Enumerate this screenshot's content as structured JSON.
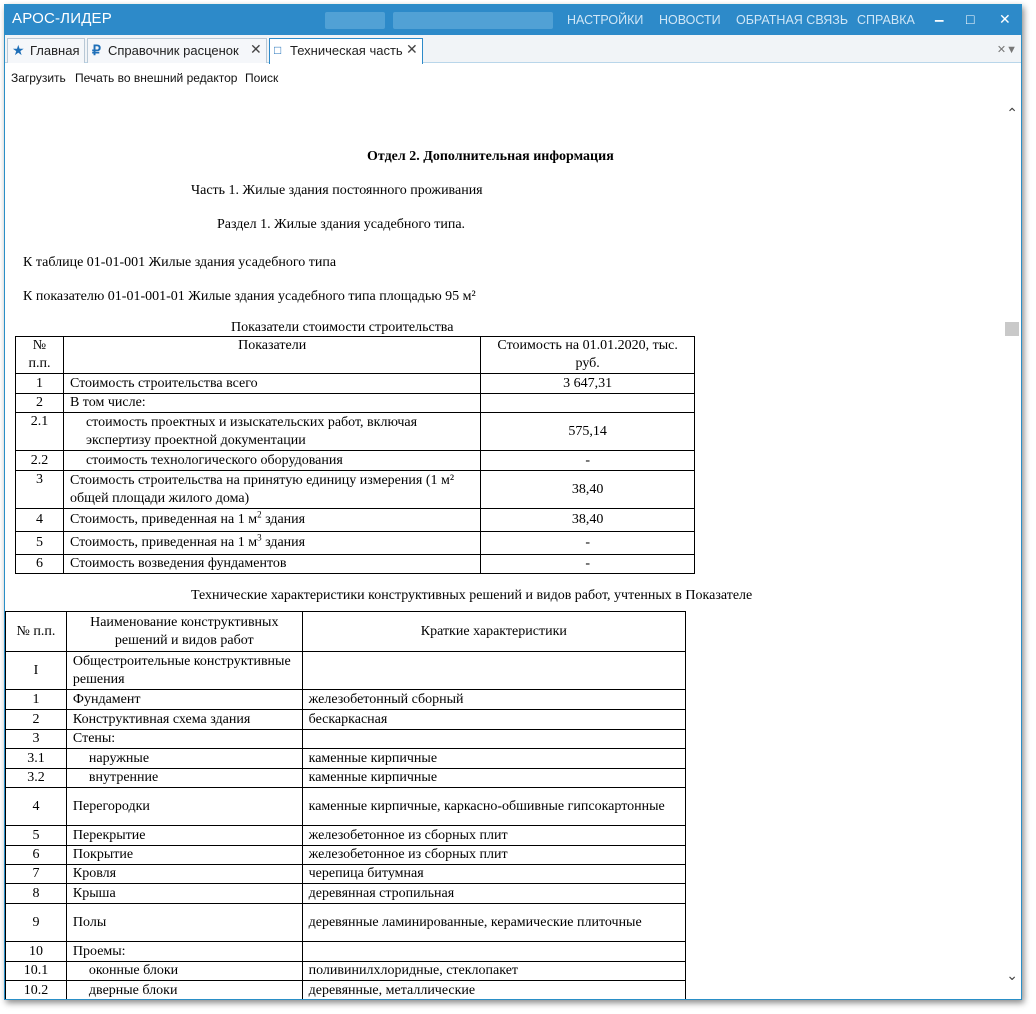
{
  "app": {
    "title": "АРОС-ЛИДЕР",
    "menu": [
      "НАСТРОЙКИ",
      "НОВОСТИ",
      "ОБРАТНАЯ СВЯЗЬ",
      "СПРАВКА"
    ],
    "window_controls": {
      "minimize": "▁",
      "maximize": "□",
      "close": "✕"
    }
  },
  "tabs": [
    {
      "label": "Главная",
      "icon": "star-icon",
      "glyph": "★"
    },
    {
      "label": "Справочник расценок",
      "icon": "ruble-icon",
      "glyph": "₽",
      "close": "✕"
    },
    {
      "label": "Техническая часть",
      "icon": "book-icon",
      "glyph": "📖",
      "close": "✕"
    }
  ],
  "tab_menu": "✕▼",
  "toolbar": {
    "load": "Загрузить",
    "print": "Печать во внешний редактор",
    "search": "Поиск"
  },
  "document": {
    "heading": "Отдел 2. Дополнительная информация",
    "part": "Часть 1. Жилые здания постоянного проживания",
    "section": "Раздел 1. Жилые здания усадебного типа.",
    "table_ref": "К таблице 01-01-001 Жилые здания усадебного типа",
    "indicator_ref": "К показателю 01-01-001-01 Жилые здания усадебного типа площадью 95 м²",
    "table1_caption": "Показатели стоимости строительства",
    "table1_headers": [
      "№ п.п.",
      "Показатели",
      "Стоимость  на 01.01.2020, тыс. руб."
    ],
    "table1_rows": [
      {
        "num": "1",
        "name": "Стоимость строительства всего",
        "value": "3 647,31"
      },
      {
        "num": "2",
        "name": "В том числе:",
        "value": ""
      },
      {
        "num": "2.1",
        "name": "стоимость проектных и изыскательских работ, включая экспертизу проектной документации",
        "value": "575,14"
      },
      {
        "num": "2.2",
        "name": "стоимость технологического оборудования",
        "value": "-"
      },
      {
        "num": "3",
        "name": "Стоимость строительства на принятую единицу измерения (1 м² общей площади жилого дома)",
        "value": "38,40"
      },
      {
        "num": "4",
        "name_pre": "Стоимость, приведенная на 1 м",
        "sup": "2",
        "name_post": " здания",
        "value": "38,40"
      },
      {
        "num": "5",
        "name_pre": "Стоимость, приведенная на 1 м",
        "sup": "3",
        "name_post": " здания",
        "value": "-"
      },
      {
        "num": "6",
        "name": "Стоимость возведения фундаментов",
        "value": "-"
      }
    ],
    "table2_caption": "Технические характеристики конструктивных решений  и видов работ, учтенных в Показателе",
    "table2_headers": [
      "№ п.п.",
      "Наименование конструктивных решений и видов работ",
      "Краткие характеристики"
    ],
    "table2_rows": [
      {
        "num": "I",
        "name": "Общестроительные конструктивные решения",
        "desc": ""
      },
      {
        "num": "1",
        "name": "Фундамент",
        "desc": "железобетонный сборный"
      },
      {
        "num": "2",
        "name": "Конструктивная схема здания",
        "desc": "бескаркасная"
      },
      {
        "num": "3",
        "name": "Стены:",
        "desc": ""
      },
      {
        "num": "3.1",
        "name": "наружные",
        "desc": "каменные кирпичные"
      },
      {
        "num": "3.2",
        "name": "внутренние",
        "desc": "каменные кирпичные"
      },
      {
        "num": "4",
        "name": "Перегородки",
        "desc": "каменные кирпичные, каркасно-обшивные гипсокартонные"
      },
      {
        "num": "5",
        "name": "Перекрытие",
        "desc": "железобетонное из сборных плит"
      },
      {
        "num": "6",
        "name": "Покрытие",
        "desc": "железобетонное из сборных плит"
      },
      {
        "num": "7",
        "name": "Кровля",
        "desc": "черепица битумная"
      },
      {
        "num": "8",
        "name": "Крыша",
        "desc": "деревянная стропильная"
      },
      {
        "num": "9",
        "name": "Полы",
        "desc": "деревянные ламинированные, керамические плиточные"
      },
      {
        "num": "10",
        "name": "Проемы:",
        "desc": ""
      },
      {
        "num": "10.1",
        "name": "оконные блоки",
        "desc": "поливинилхлоридные, стеклопакет"
      },
      {
        "num": "10.2",
        "name": "дверные блоки",
        "desc": "деревянные, металлические"
      }
    ]
  },
  "scroll": {
    "up": "⌃",
    "down": "⌄"
  }
}
